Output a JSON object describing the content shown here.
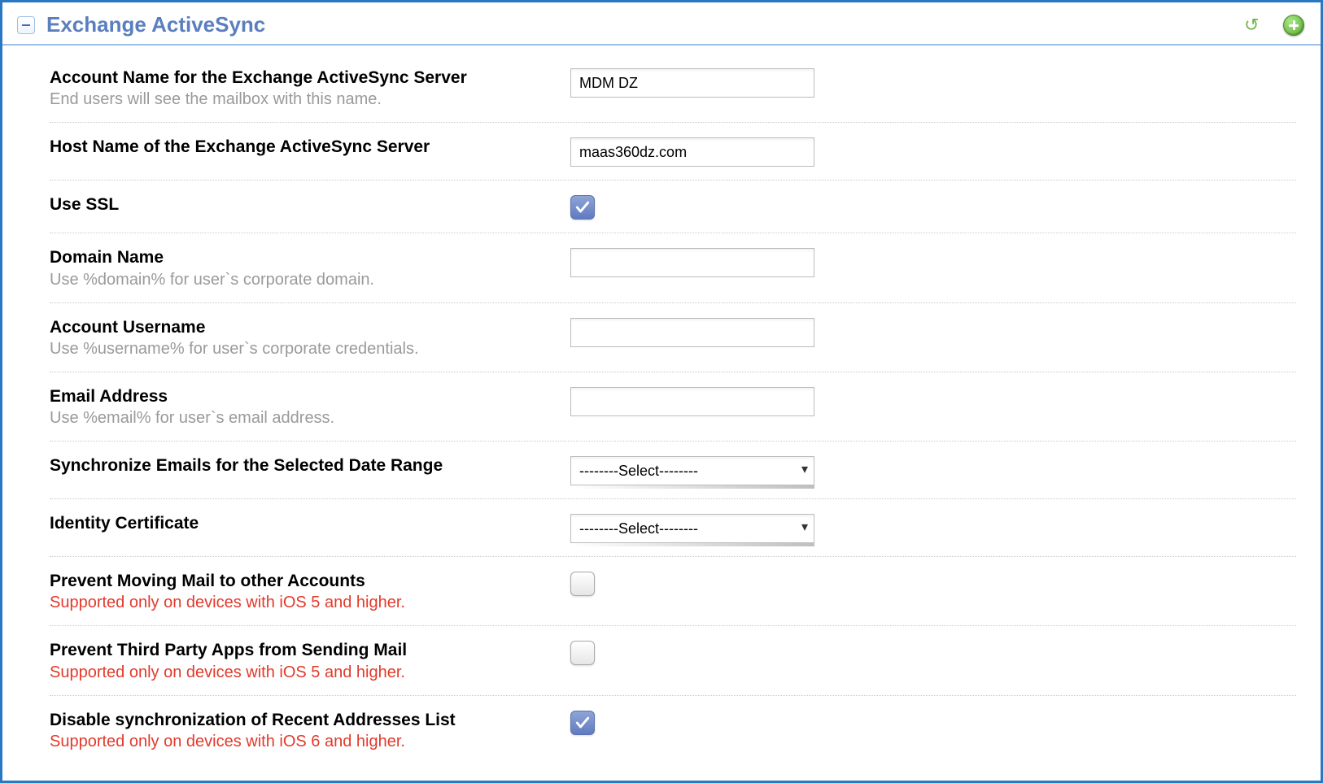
{
  "section": {
    "title": "Exchange ActiveSync"
  },
  "fields": {
    "accountName": {
      "label": "Account Name for the Exchange ActiveSync Server",
      "hint": "End users will see the mailbox with this name.",
      "value": "MDM DZ"
    },
    "hostName": {
      "label": "Host Name of the Exchange ActiveSync Server",
      "value": "maas360dz.com"
    },
    "useSSL": {
      "label": "Use SSL",
      "checked": true
    },
    "domainName": {
      "label": "Domain Name",
      "hint": "Use %domain% for user`s corporate domain.",
      "value": ""
    },
    "accountUsername": {
      "label": "Account Username",
      "hint": "Use %username% for user`s corporate credentials.",
      "value": ""
    },
    "emailAddress": {
      "label": "Email Address",
      "hint": "Use %email% for user`s email address.",
      "value": ""
    },
    "syncRange": {
      "label": "Synchronize Emails for the Selected Date Range",
      "selected": "--------Select--------"
    },
    "identityCert": {
      "label": "Identity Certificate",
      "selected": "--------Select--------"
    },
    "preventMove": {
      "label": "Prevent Moving Mail to other Accounts",
      "warn": "Supported only on devices with iOS 5 and higher.",
      "checked": false
    },
    "preventThirdParty": {
      "label": "Prevent Third Party Apps from Sending Mail",
      "warn": "Supported only on devices with iOS 5 and higher.",
      "checked": false
    },
    "disableRecent": {
      "label": "Disable synchronization of Recent Addresses List",
      "warn": "Supported only on devices with iOS 6 and higher.",
      "checked": true
    }
  }
}
